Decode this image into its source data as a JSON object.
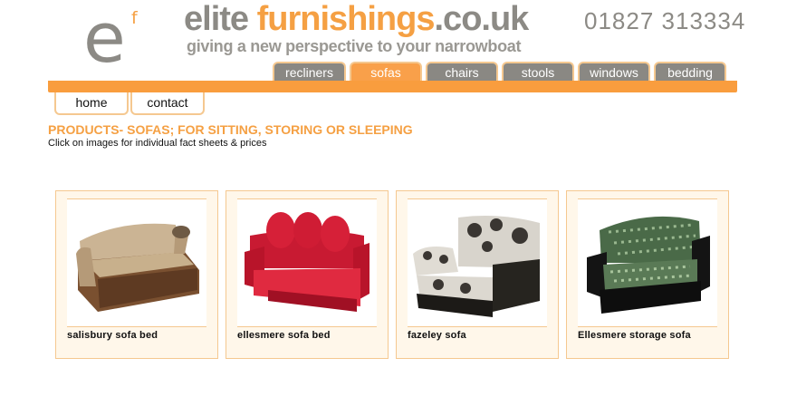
{
  "header": {
    "logo_e": "e",
    "logo_f": "f",
    "brand_part1": "elite ",
    "brand_part2": "furnishings",
    "brand_part3": ".co.uk",
    "tagline": "giving a new perspective to your narrowboat",
    "phone": "01827 313334"
  },
  "categories": [
    {
      "label": "recliners",
      "active": false
    },
    {
      "label": "sofas",
      "active": true
    },
    {
      "label": "chairs",
      "active": false
    },
    {
      "label": "stools",
      "active": false
    },
    {
      "label": "windows",
      "active": false
    },
    {
      "label": "bedding",
      "active": false
    }
  ],
  "subnav": [
    {
      "label": "home"
    },
    {
      "label": "contact"
    }
  ],
  "page": {
    "heading": "PRODUCTS- SOFAS; FOR SITTING, STORING OR SLEEPING",
    "subheading": "Click on images for individual fact sheets & prices"
  },
  "products": [
    {
      "name": "salisbury sofa bed",
      "image": "beige-sofa-bed-photo"
    },
    {
      "name": "ellesmere sofa bed",
      "image": "red-sofa-bed-photo"
    },
    {
      "name": "fazeley sofa",
      "image": "floral-sofa-photo"
    },
    {
      "name": "Ellesmere storage sofa",
      "image": "green-storage-sofa-photo"
    }
  ],
  "colors": {
    "accent": "#f99d3e",
    "tab_grey": "#8a8883",
    "card_border": "#f5c890",
    "card_bg": "#fff7ea"
  }
}
